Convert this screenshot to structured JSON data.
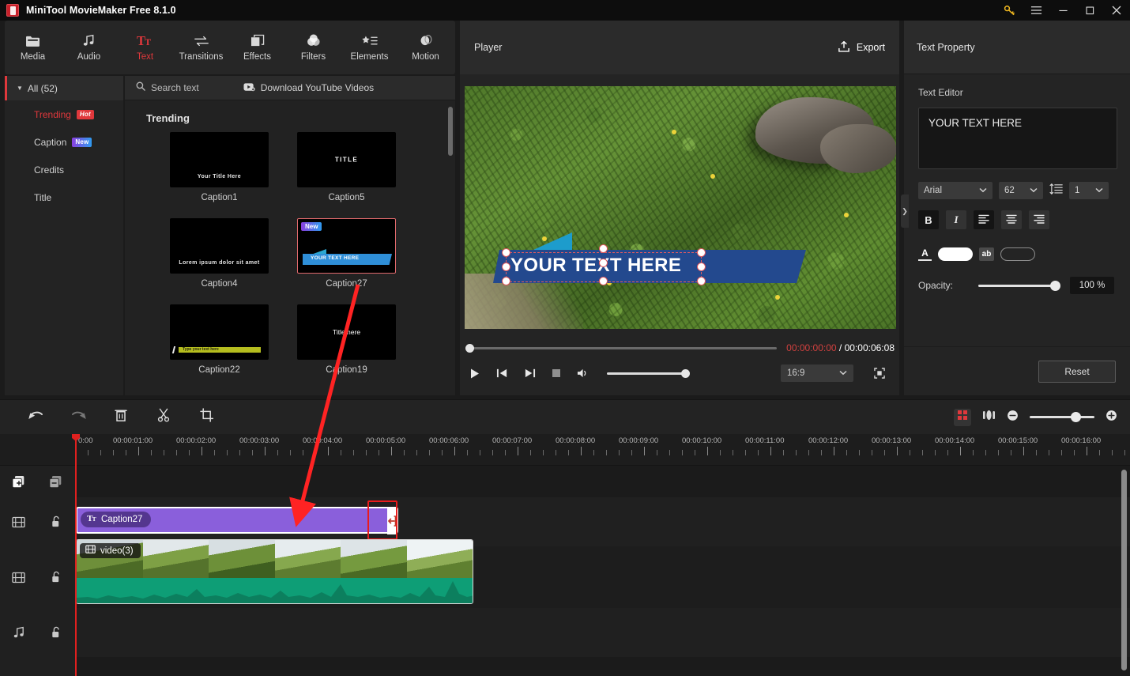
{
  "window": {
    "title": "MiniTool MovieMaker Free 8.1.0",
    "controls": {
      "key": "key-icon",
      "menu": "hamburger-menu-icon",
      "minimize": "minimize-icon",
      "maximize": "maximize-icon",
      "close": "close-icon"
    }
  },
  "modules": [
    {
      "label": "Media",
      "icon": "folder-icon",
      "active": false
    },
    {
      "label": "Audio",
      "icon": "music-note-icon",
      "active": false
    },
    {
      "label": "Text",
      "icon": "text-tt-icon",
      "active": true
    },
    {
      "label": "Transitions",
      "icon": "transitions-icon",
      "active": false
    },
    {
      "label": "Effects",
      "icon": "effects-icon",
      "active": false
    },
    {
      "label": "Filters",
      "icon": "filters-icon",
      "active": false
    },
    {
      "label": "Elements",
      "icon": "elements-icon",
      "active": false
    },
    {
      "label": "Motion",
      "icon": "motion-icon",
      "active": false
    }
  ],
  "categories": {
    "all_label": "All (52)",
    "items": [
      {
        "label": "Trending",
        "badge": "Hot",
        "badge_type": "hot",
        "selected": true
      },
      {
        "label": "Caption",
        "badge": "New",
        "badge_type": "new",
        "selected": false
      },
      {
        "label": "Credits",
        "badge": "",
        "badge_type": "",
        "selected": false
      },
      {
        "label": "Title",
        "badge": "",
        "badge_type": "",
        "selected": false
      }
    ]
  },
  "library": {
    "search_placeholder": "Search text",
    "search_icon": "search-icon",
    "download_label": "Download YouTube Videos",
    "download_icon": "youtube-download-icon",
    "section_title": "Trending",
    "templates": [
      {
        "name": "Caption1",
        "preview_text": "Your  Title Here",
        "style": "small-bottom",
        "badge": "",
        "selected": false
      },
      {
        "name": "Caption5",
        "preview_text": "TITLE",
        "style": "center-caps",
        "badge": "",
        "selected": false
      },
      {
        "name": "Caption4",
        "preview_text": "Lorem ipsum dolor sit amet",
        "style": "small-bottom",
        "badge": "",
        "selected": false
      },
      {
        "name": "Caption27",
        "preview_text": "YOUR TEXT HERE",
        "style": "blue-banner",
        "badge": "New",
        "selected": true
      },
      {
        "name": "Caption22",
        "preview_text": "Type your text here",
        "style": "yellow-bar",
        "badge": "",
        "selected": false
      },
      {
        "name": "Caption19",
        "preview_text": "Title here",
        "style": "center-plain",
        "badge": "",
        "selected": false
      }
    ]
  },
  "player": {
    "label": "Player",
    "export_label": "Export",
    "export_icon": "export-upload-icon",
    "overlay_text": "YOUR TEXT HERE",
    "current_time": "00:00:00:00",
    "time_separator": " / ",
    "total_time": "00:00:06:08",
    "aspect_ratio": "16:9",
    "controls": {
      "play": "play-icon",
      "prev_frame": "previous-frame-icon",
      "next_frame": "next-frame-icon",
      "stop": "stop-icon",
      "volume": "volume-icon",
      "fullscreen": "fullscreen-icon"
    }
  },
  "text_property": {
    "panel_title": "Text Property",
    "editor_label": "Text Editor",
    "editor_value": "YOUR TEXT HERE",
    "font_family": "Arial",
    "font_size": "62",
    "line_height": "1",
    "line_height_icon": "line-spacing-icon",
    "bold_label": "B",
    "italic_label": "I",
    "align_left_icon": "align-left-icon",
    "align_center_icon": "align-center-icon",
    "align_right_icon": "align-right-icon",
    "text_color_icon": "font-color-icon",
    "text_color": "#ffffff",
    "outline_icon": "ab-outline-icon",
    "outline_color": "none",
    "opacity_label": "Opacity:",
    "opacity_value": "100 %",
    "reset_label": "Reset",
    "collapse_icon": "chevron-right-icon"
  },
  "timeline": {
    "tools": [
      {
        "name": "undo",
        "icon": "undo-icon",
        "enabled": true
      },
      {
        "name": "redo",
        "icon": "redo-icon",
        "enabled": false
      },
      {
        "name": "delete",
        "icon": "trash-icon",
        "enabled": true
      },
      {
        "name": "split",
        "icon": "scissors-icon",
        "enabled": true
      },
      {
        "name": "crop",
        "icon": "crop-icon",
        "enabled": true
      }
    ],
    "right_tools": [
      {
        "name": "split-view",
        "icon": "split-view-icon"
      },
      {
        "name": "audio-split",
        "icon": "audio-detach-icon"
      }
    ],
    "zoom_out_icon": "zoom-out-icon",
    "zoom_in_icon": "zoom-in-icon",
    "add_track_icon": "add-track-icon",
    "remove_track_icon": "remove-track-icon",
    "ruler_labels": [
      "0:00",
      "00:00:01:00",
      "00:00:02:00",
      "00:00:03:00",
      "00:00:04:00",
      "00:00:05:00",
      "00:00:06:00",
      "00:00:07:00",
      "00:00:08:00",
      "00:00:09:00",
      "00:00:10:00",
      "00:00:11:00",
      "00:00:12:00",
      "00:00:13:00",
      "00:00:14:00",
      "00:00:15:00",
      "00:00:16:00"
    ],
    "tracks": [
      {
        "type": "text",
        "icon": "film-track-icon",
        "lock_icon": "unlock-icon"
      },
      {
        "type": "video",
        "icon": "film-track-icon",
        "lock_icon": "unlock-icon"
      },
      {
        "type": "audio",
        "icon": "music-track-icon",
        "lock_icon": "unlock-icon"
      }
    ],
    "clips": [
      {
        "label": "Caption27",
        "type": "text",
        "icon": "text-tt-icon",
        "selected": true
      },
      {
        "label": "video(3)",
        "type": "video",
        "icon": "film-clip-icon",
        "selected": false
      }
    ],
    "trim_handle_icon": "trim-left-arrow-icon"
  }
}
